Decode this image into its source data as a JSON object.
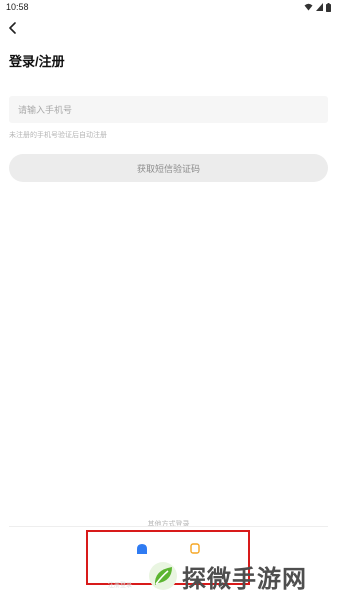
{
  "status_bar": {
    "time": "10:58"
  },
  "header": {
    "back_icon": "chevron-left-icon",
    "title": "登录/注册"
  },
  "form": {
    "phone_placeholder": "请输入手机号",
    "phone_value": "",
    "hint": "未注册的手机号验证后自动注册",
    "sms_button_label": "获取短信验证码"
  },
  "other_login": {
    "label": "其他方式登录",
    "options": [
      {
        "icon": "person-icon",
        "color": "#2f7bf2"
      },
      {
        "icon": "device-icon",
        "color": "#f5a623"
      }
    ],
    "faint_text": "注册登录"
  },
  "watermark": {
    "logo_icon": "leaf-logo-icon",
    "text": "探微手游网"
  },
  "colors": {
    "highlight_border": "#d81a1a",
    "input_bg": "#f6f6f6",
    "button_bg": "#ececec",
    "watermark_green": "#5cb531"
  }
}
